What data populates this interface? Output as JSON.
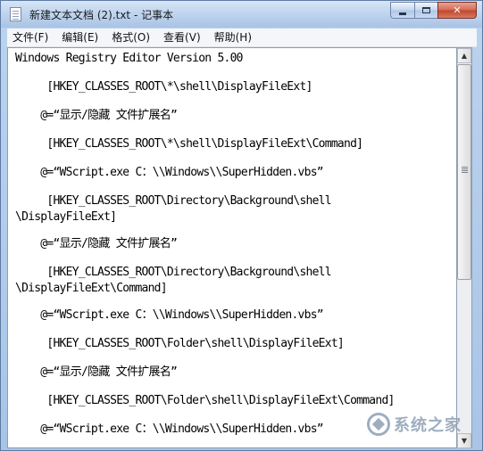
{
  "window": {
    "title": "新建文本文档 (2).txt - 记事本"
  },
  "caption_buttons": {
    "minimize_icon": "minimize-icon",
    "maximize_icon": "maximize-icon",
    "close_label": "✕"
  },
  "menu": {
    "items": [
      {
        "label": "文件(F)"
      },
      {
        "label": "编辑(E)"
      },
      {
        "label": "格式(O)"
      },
      {
        "label": "查看(V)"
      },
      {
        "label": "帮助(H)"
      }
    ]
  },
  "editor": {
    "lines": [
      "Windows Registry Editor Version 5.00",
      "     [HKEY_CLASSES_ROOT\\*\\shell\\DisplayFileExt]",
      "    @=“显示/隐藏 文件扩展名”",
      "     [HKEY_CLASSES_ROOT\\*\\shell\\DisplayFileExt\\Command]",
      "    @=“WScript.exe C：\\\\Windows\\\\SuperHidden.vbs”",
      "     [HKEY_CLASSES_ROOT\\Directory\\Background\\shell\n\\DisplayFileExt]",
      "    @=“显示/隐藏 文件扩展名”",
      "     [HKEY_CLASSES_ROOT\\Directory\\Background\\shell\n\\DisplayFileExt\\Command]",
      "    @=“WScript.exe C：\\\\Windows\\\\SuperHidden.vbs”",
      "     [HKEY_CLASSES_ROOT\\Folder\\shell\\DisplayFileExt]",
      "    @=“显示/隐藏 文件扩展名”",
      "     [HKEY_CLASSES_ROOT\\Folder\\shell\\DisplayFileExt\\Command]",
      "    @=“WScript.exe C：\\\\Windows\\\\SuperHidden.vbs”"
    ]
  },
  "scrollbar": {
    "up_icon": "▲",
    "down_icon": "▼"
  },
  "watermark": {
    "text": "系统之家"
  }
}
